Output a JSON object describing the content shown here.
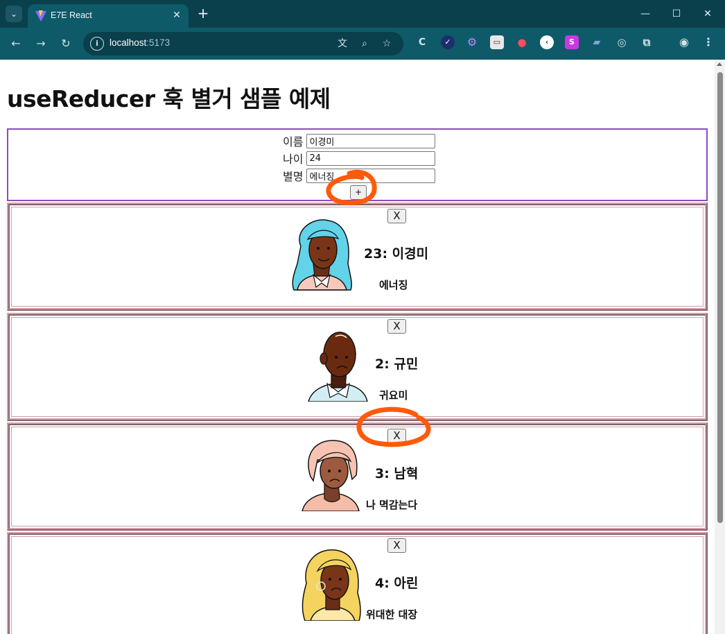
{
  "browser": {
    "tab_title": "E7E React",
    "url_host": "localhost",
    "url_port": ":5173",
    "new_tab": "+",
    "tab_close": "✕",
    "tab_menu": "⌄"
  },
  "page": {
    "title": "useReducer 훅 별거 샘플 예제",
    "form": {
      "name_label": "이름",
      "name_value": "이경미",
      "age_label": "나이",
      "age_value": "24",
      "nick_label": "별명",
      "nick_value": "에너징",
      "add_label": "+"
    },
    "cards": [
      {
        "remove_label": "X",
        "heading": "23: 이경미",
        "nickname": "에너징",
        "avatar": "woman-blue-hair-avatar"
      },
      {
        "remove_label": "X",
        "heading": "2: 규민",
        "nickname": "귀요미",
        "avatar": "bald-man-avatar"
      },
      {
        "remove_label": "X",
        "heading": "3: 남혁",
        "nickname": "나 멱감는다",
        "avatar": "pink-hair-avatar"
      },
      {
        "remove_label": "X",
        "heading": "4: 아린",
        "nickname": "위대한 대장",
        "avatar": "yellow-hair-avatar"
      }
    ]
  },
  "colors": {
    "chrome_dark": "#0a3f4c",
    "chrome_toolbar": "#0e5a69",
    "form_border": "#8b4bc4",
    "card_border": "#d6a1ab",
    "annotation": "#ff5a0a"
  }
}
